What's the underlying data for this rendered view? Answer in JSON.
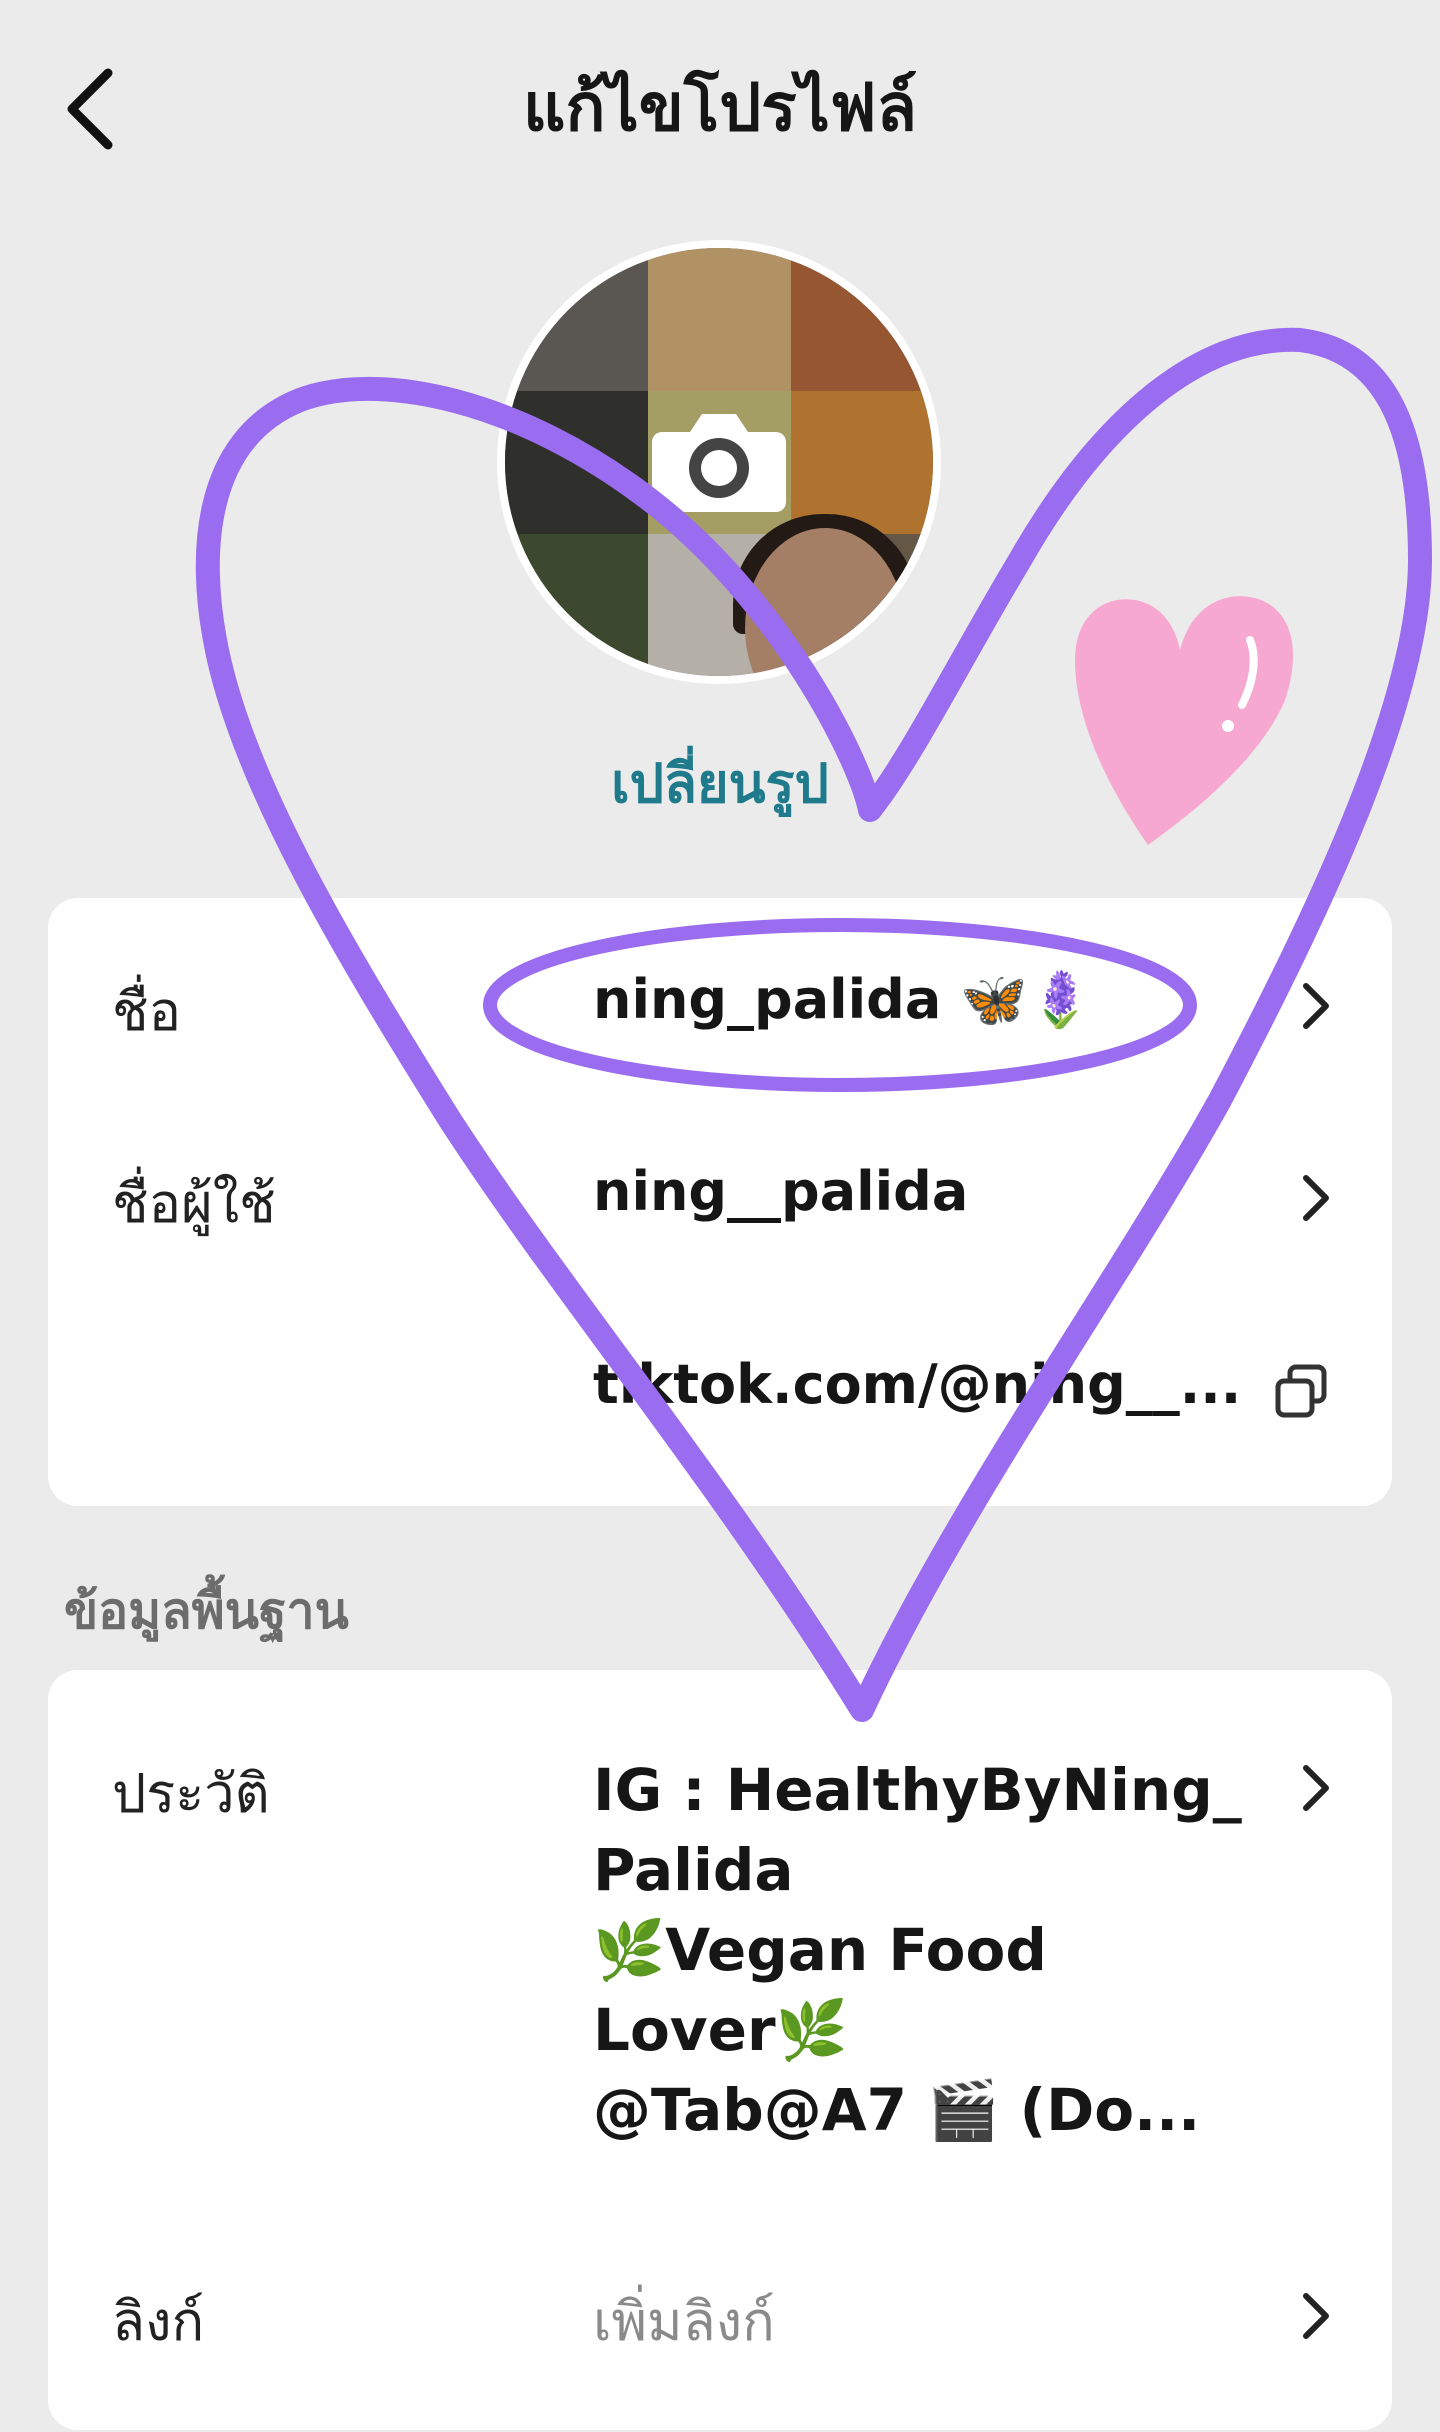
{
  "header": {
    "title": "แก้ไขโปรไฟล์"
  },
  "avatar": {
    "change_label": "เปลี่ยนรูป"
  },
  "profile_card": {
    "name_label": "ชื่อ",
    "name_value": "ning_palida 🦋🪻",
    "username_label": "ชื่อผู้ใช้",
    "username_value": "ning__palida",
    "link_value": "tiktok.com/@ning__..."
  },
  "basic_section": {
    "title": "ข้อมูลพื้นฐาน"
  },
  "basic_card": {
    "bio_label": "ประวัติ",
    "bio_lines": [
      "IG : HealthyByNing_",
      "Palida",
      "🌿Vegan Food",
      "Lover🌿",
      "@Tab@A7 🎬 (Do..."
    ],
    "link_label": "ลิงก์",
    "link_placeholder": "เพิ่มลิงก์"
  },
  "colors": {
    "accent": "#1f7a8c",
    "annotation_heart": "#9a6cf0",
    "pink_sticker": "#f7a8d0"
  },
  "icons": [
    "back-arrow-icon",
    "camera-icon",
    "chevron-right-icon",
    "copy-icon",
    "heart-sticker-icon"
  ]
}
